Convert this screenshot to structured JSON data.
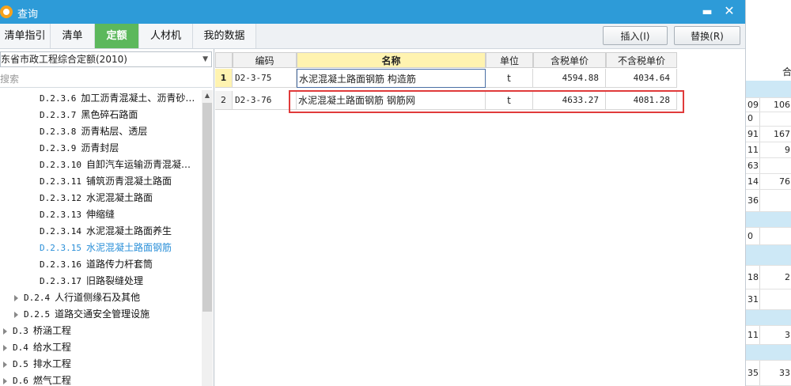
{
  "window": {
    "title": "查询",
    "minimize_glyph": "▬",
    "close_glyph": "✕"
  },
  "tabs": [
    {
      "label": "清单指引",
      "active": false
    },
    {
      "label": "清单",
      "active": false
    },
    {
      "label": "定额",
      "active": true
    },
    {
      "label": "人材机",
      "active": false
    },
    {
      "label": "我的数据",
      "active": false
    }
  ],
  "toolbar": {
    "insert_label": "插入(I)",
    "replace_label": "替换(R)"
  },
  "left_panel": {
    "quota_library": "东省市政工程综合定额(2010)",
    "search_placeholder": "搜索",
    "tree": [
      {
        "code": "D.2.3.6",
        "label": "加工沥青混凝土、沥青砂…",
        "level": 3,
        "selected": false
      },
      {
        "code": "D.2.3.7",
        "label": "黑色碎石路面",
        "level": 3,
        "selected": false
      },
      {
        "code": "D.2.3.8",
        "label": "沥青粘层、透层",
        "level": 3,
        "selected": false
      },
      {
        "code": "D.2.3.9",
        "label": "沥青封层",
        "level": 3,
        "selected": false
      },
      {
        "code": "D.2.3.10",
        "label": "自卸汽车运输沥青混凝…",
        "level": 3,
        "selected": false
      },
      {
        "code": "D.2.3.11",
        "label": "铺筑沥青混凝土路面",
        "level": 3,
        "selected": false
      },
      {
        "code": "D.2.3.12",
        "label": "水泥混凝土路面",
        "level": 3,
        "selected": false
      },
      {
        "code": "D.2.3.13",
        "label": "伸缩缝",
        "level": 3,
        "selected": false
      },
      {
        "code": "D.2.3.14",
        "label": "水泥混凝土路面养生",
        "level": 3,
        "selected": false
      },
      {
        "code": "D.2.3.15",
        "label": "水泥混凝土路面钢筋",
        "level": 3,
        "selected": true
      },
      {
        "code": "D.2.3.16",
        "label": "道路传力杆套筒",
        "level": 3,
        "selected": false
      },
      {
        "code": "D.2.3.17",
        "label": "旧路裂缝处理",
        "level": 3,
        "selected": false
      },
      {
        "code": "D.2.4",
        "label": "人行道侧缘石及其他",
        "level": 2,
        "selected": false
      },
      {
        "code": "D.2.5",
        "label": "道路交通安全管理设施",
        "level": 2,
        "selected": false
      },
      {
        "code": "D.3",
        "label": "桥涵工程",
        "level": 1,
        "selected": false
      },
      {
        "code": "D.4",
        "label": "给水工程",
        "level": 1,
        "selected": false
      },
      {
        "code": "D.5",
        "label": "排水工程",
        "level": 1,
        "selected": false
      },
      {
        "code": "D.6",
        "label": "燃气工程",
        "level": 1,
        "selected": false
      }
    ]
  },
  "table": {
    "columns": [
      "编码",
      "名称",
      "单位",
      "含税单价",
      "不含税单价"
    ],
    "rows": [
      {
        "index": "1",
        "code": "D2-3-75",
        "name": "水泥混凝土路面钢筋 构造筋",
        "unit": "t",
        "price_tax": "4594.88",
        "price_notax": "4034.64"
      },
      {
        "index": "2",
        "code": "D2-3-76",
        "name": "水泥混凝土路面钢筋 钢筋网",
        "unit": "t",
        "price_tax": "4633.27",
        "price_notax": "4081.28"
      }
    ]
  },
  "background_window": {
    "header": "合",
    "rows": [
      {
        "a": "",
        "b": "",
        "blue": true
      },
      {
        "a": "09",
        "b": "106",
        "blue": false
      },
      {
        "a": "0",
        "b": "",
        "blue": false
      },
      {
        "a": "91",
        "b": "167",
        "blue": false
      },
      {
        "a": "11",
        "b": "9",
        "blue": false
      },
      {
        "a": "63",
        "b": "",
        "blue": false
      },
      {
        "a": "14",
        "b": "76",
        "blue": false
      },
      {
        "a": "36",
        "b": "",
        "blue": false
      },
      {
        "a": "",
        "b": "",
        "blue": true
      },
      {
        "a": "0",
        "b": "",
        "blue": false
      },
      {
        "a": "",
        "b": "",
        "blue": true
      },
      {
        "a": "18",
        "b": "2",
        "blue": false
      },
      {
        "a": "31",
        "b": "",
        "blue": false
      },
      {
        "a": "",
        "b": "",
        "blue": true
      },
      {
        "a": "11",
        "b": "3",
        "blue": false
      },
      {
        "a": "",
        "b": "",
        "blue": true
      },
      {
        "a": "35",
        "b": "33",
        "blue": false
      }
    ]
  }
}
